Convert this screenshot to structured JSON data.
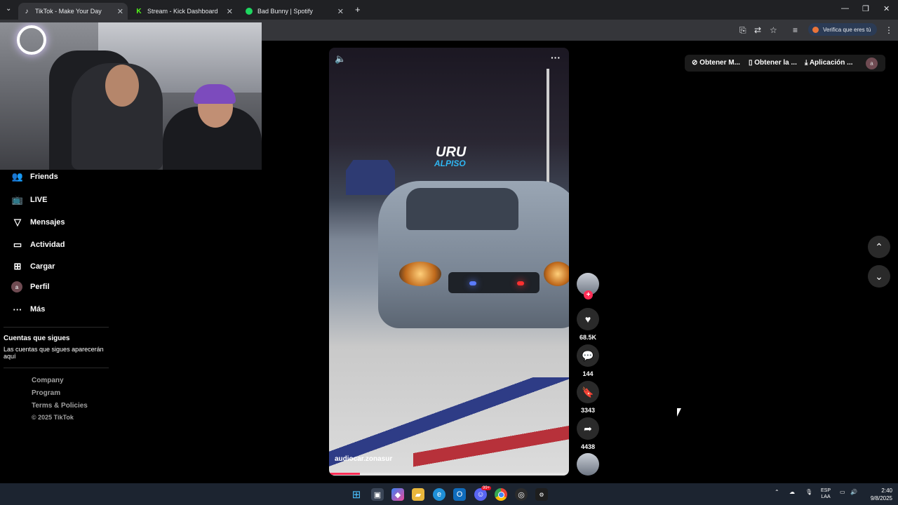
{
  "browser": {
    "tabs": [
      {
        "label": "TikTok - Make Your Day",
        "icon": "tiktok-icon",
        "active": true
      },
      {
        "label": "Stream - Kick Dashboard",
        "icon": "kick-icon",
        "active": false
      },
      {
        "label": "Bad Bunny | Spotify",
        "icon": "spotify-icon",
        "active": false
      }
    ],
    "new_tab": "+",
    "verify_label": "Verifica que eres tú"
  },
  "webcam": {
    "label": "webcam-overlay"
  },
  "sidebar": {
    "items": [
      {
        "label": "Friends",
        "icon": "friends-icon"
      },
      {
        "label": "LIVE",
        "icon": "live-icon"
      },
      {
        "label": "Mensajes",
        "icon": "messages-icon"
      },
      {
        "label": "Actividad",
        "icon": "activity-icon"
      },
      {
        "label": "Cargar",
        "icon": "upload-icon"
      },
      {
        "label": "Perfil",
        "icon": "profile-avatar",
        "avatar_letter": "a"
      },
      {
        "label": "Más",
        "icon": "more-icon"
      }
    ],
    "following_title": "Cuentas que sigues",
    "following_empty": "Las cuentas que sigues aparecerán aquí",
    "footer": {
      "company": "Company",
      "program": "Program",
      "terms": "Terms & Policies",
      "copyright": "© 2025 TikTok"
    }
  },
  "video": {
    "username": "audiocar.zonasur",
    "overlay_text_1": "URU",
    "overlay_text_2": "ALPISO",
    "more": "···"
  },
  "actions": {
    "likes": "68.5K",
    "comments": "144",
    "saves": "3343",
    "shares": "4438"
  },
  "top_buttons": {
    "get_coins": "Obtener M...",
    "get_app": "Obtener la ...",
    "desktop_app": "Aplicación ...",
    "avatar_letter": "a"
  },
  "taskbar": {
    "lang_top": "ESP",
    "lang_bottom": "LAA",
    "time": "2:40",
    "date": "9/8/2025",
    "badge": "99+"
  },
  "colors": {
    "accent": "#fe2c55",
    "background": "#000000"
  }
}
